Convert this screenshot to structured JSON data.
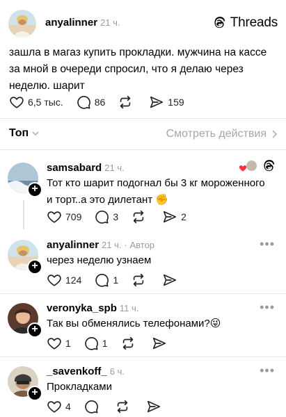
{
  "post": {
    "username": "anyalinner",
    "time": "21 ч.",
    "brand": "Threads",
    "text": "зашла в магаз купить прокладки. мужчина на кассе за мной в очереди спросил, что я делаю через неделю. шарит",
    "likes": "6,5 тыс.",
    "replies": "86",
    "shares": "159"
  },
  "sort": {
    "label": "Топ",
    "view_activity": "Смотреть действия"
  },
  "comments": [
    {
      "username": "samsabard",
      "time": "21 ч.",
      "text": "Тот кто шарит подогнал бы 3 кг мороженного и торт..а это дилетант ✊",
      "likes": "709",
      "replies": "3",
      "shares": "2"
    },
    {
      "username": "anyalinner",
      "time": "21 ч.",
      "author_label": "· Автор",
      "text": "через неделю узнаем",
      "likes": "124",
      "replies": "1"
    },
    {
      "username": "veronyka_spb",
      "time": "11 ч.",
      "text": "Так вы обменялись телефонами?😜",
      "likes": "1",
      "replies": "1"
    },
    {
      "username": "_savenkoff_",
      "time": "6 ч.",
      "text": "Прокладками",
      "likes": "4"
    }
  ],
  "colors": {
    "muted": "#9a9a9a",
    "divider": "#e6e6e6",
    "heart_red": "#ff3040"
  }
}
